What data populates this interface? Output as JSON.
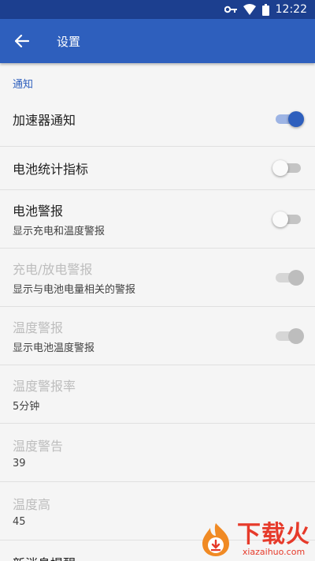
{
  "status_bar": {
    "time": "12:22"
  },
  "app_bar": {
    "title": "设置"
  },
  "section": {
    "title": "通知"
  },
  "rows": [
    {
      "title": "加速器通知",
      "subtitle": "",
      "switch": "on",
      "enabled": true
    },
    {
      "title": "电池统计指标",
      "subtitle": "",
      "switch": "off",
      "enabled": true
    },
    {
      "title": "电池警报",
      "subtitle": "显示充电和温度警报",
      "switch": "off",
      "enabled": true
    },
    {
      "title": "充电/放电警报",
      "subtitle": "显示与电池电量相关的警报",
      "switch": "on",
      "enabled": false
    },
    {
      "title": "温度警报",
      "subtitle": "显示电池温度警报",
      "switch": "on",
      "enabled": false
    },
    {
      "title": "温度警报率",
      "subtitle": "5分钟",
      "enabled": false
    },
    {
      "title": "温度警告",
      "subtitle": "39",
      "enabled": false
    },
    {
      "title": "温度高",
      "subtitle": "45",
      "enabled": false
    },
    {
      "title": "新消息提醒",
      "subtitle": "",
      "enabled": true
    }
  ],
  "watermark": {
    "text": "下载火",
    "url_text": "xiazaihuo.com"
  },
  "colors": {
    "primary": "#2e5fbd",
    "status_bar": "#1c3f8f",
    "accent": "#2e5fbd"
  },
  "icons": {
    "back": "arrow-left-icon",
    "key": "key-icon",
    "wifi": "wifi-icon",
    "battery": "battery-icon"
  }
}
